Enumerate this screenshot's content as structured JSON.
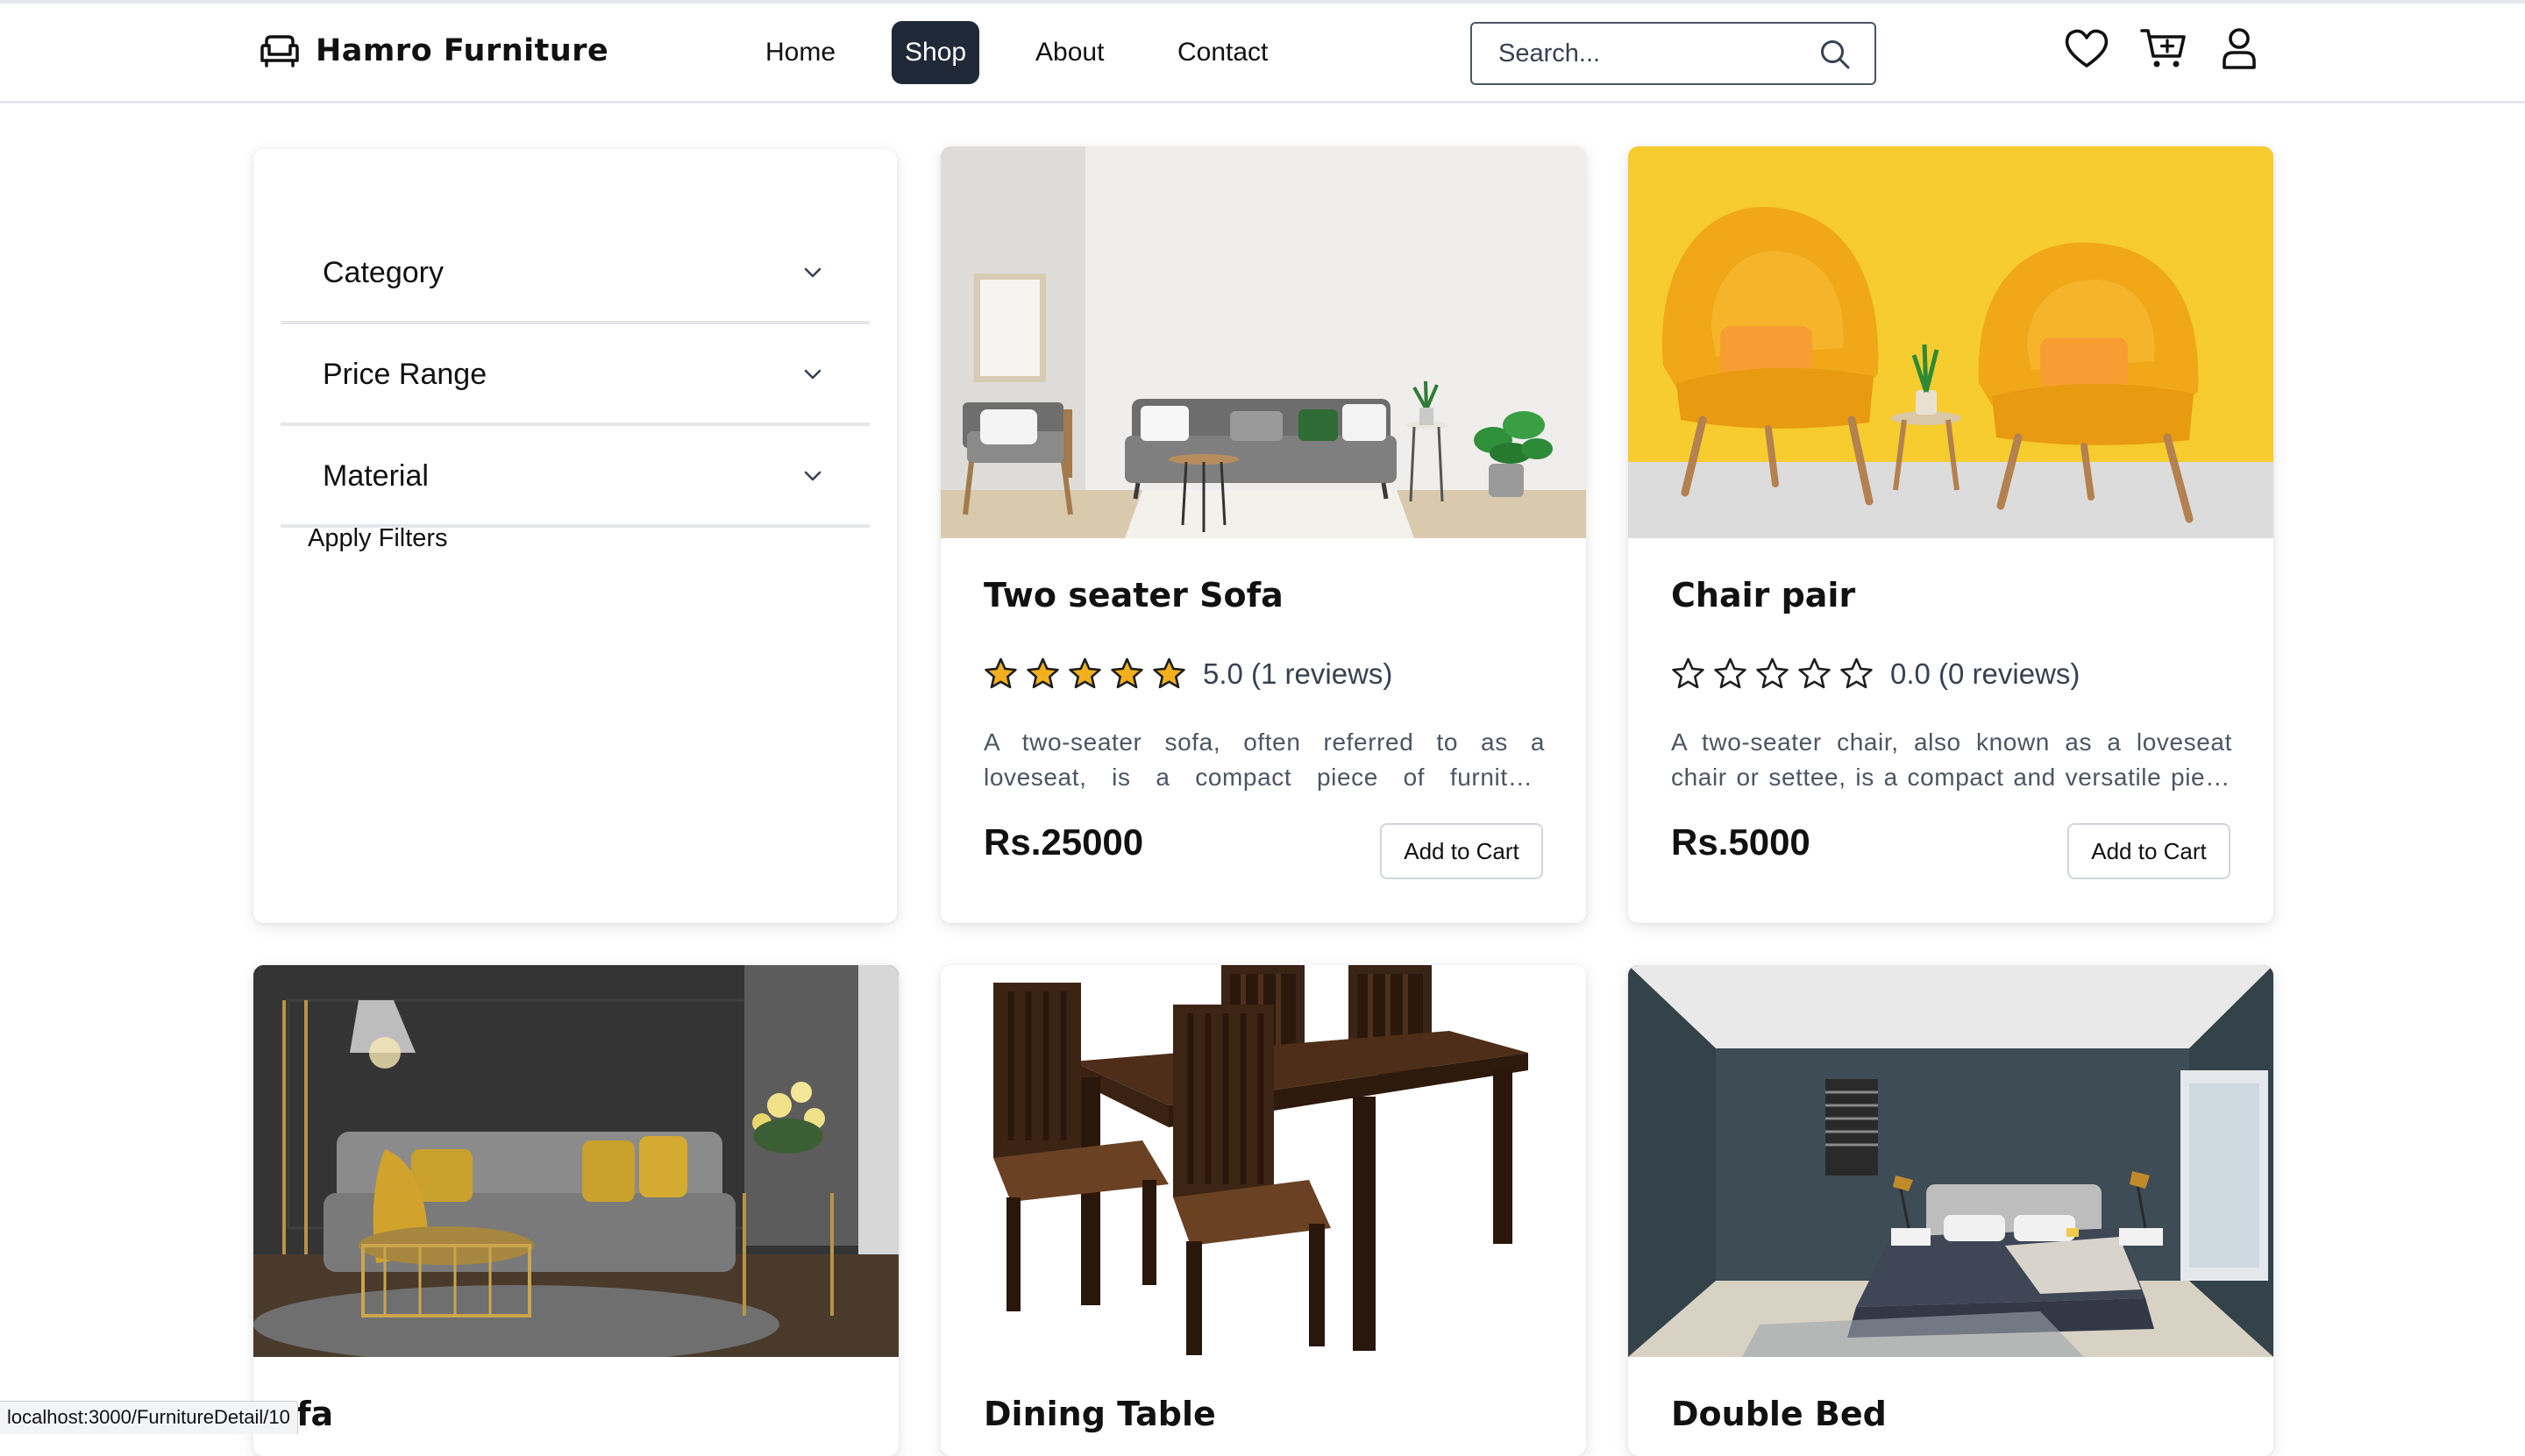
{
  "brand": {
    "name": "Hamro Furniture"
  },
  "nav": [
    {
      "label": "Home",
      "active": false
    },
    {
      "label": "Shop",
      "active": true
    },
    {
      "label": "About",
      "active": false
    },
    {
      "label": "Contact",
      "active": false
    }
  ],
  "search": {
    "placeholder": "Search...",
    "value": ""
  },
  "header_icons": [
    "heart-icon",
    "cart-plus-icon",
    "user-icon"
  ],
  "filters": {
    "items": [
      {
        "label": "Category"
      },
      {
        "label": "Price Range"
      },
      {
        "label": "Material"
      }
    ],
    "apply_label": "Apply Filters"
  },
  "products": [
    {
      "title": "Two seater Sofa",
      "rating": 5.0,
      "rating_text": "5.0 (1 reviews)",
      "description": "A two-seater sofa, often referred to as a loveseat, is a compact piece of furniture designed to comfortably seat two people.",
      "price": "Rs.25000",
      "cart_label": "Add to Cart"
    },
    {
      "title": "Chair pair",
      "rating": 0.0,
      "rating_text": "0.0 (0 reviews)",
      "description": "A two-seater chair, also known as a loveseat chair or settee, is a compact and versatile piece of furniture.",
      "price": "Rs.5000",
      "cart_label": "Add to Cart"
    },
    {
      "title": "fa"
    },
    {
      "title": "Dining Table"
    },
    {
      "title": "Double Bed"
    }
  ],
  "status_bar": {
    "url": "localhost:3000/FurnitureDetail/10"
  },
  "colors": {
    "accent_dark": "#1f2937",
    "star": "#f2b01e",
    "border": "#e5e7eb"
  }
}
